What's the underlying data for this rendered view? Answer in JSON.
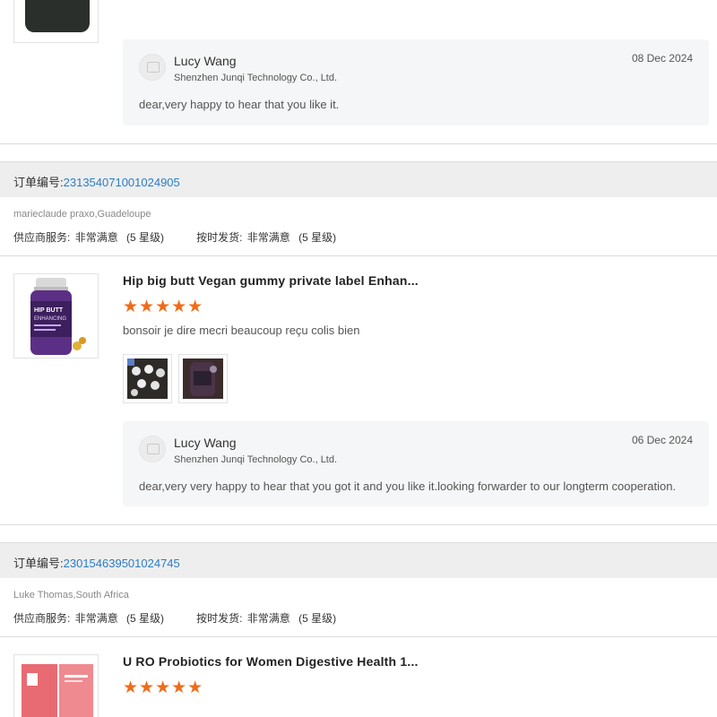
{
  "top_reply": {
    "name": "Lucy Wang",
    "company": "Shenzhen Junqi Technology Co., Ltd.",
    "date": "08 Dec 2024",
    "text": "dear,very happy to hear that you like it."
  },
  "orders": [
    {
      "label": "订单编号:",
      "number": "231354071001024905",
      "buyer": "marieclaude praxo,Guadeloupe",
      "supplier_service_label": "供应商服务:",
      "supplier_service_value": "非常满意",
      "supplier_service_level": "(5 星级)",
      "shipping_label": "按时发货:",
      "shipping_value": "非常满意",
      "shipping_level": "(5 星级)",
      "product_title": "Hip big butt Vegan gummy private label Enhan...",
      "stars": "★★★★★",
      "rating": 5,
      "review": "bonsoir  je dire  mecri beaucoup  reçu colis bien",
      "reply": {
        "name": "Lucy Wang",
        "company": "Shenzhen Junqi Technology Co., Ltd.",
        "date": "06 Dec 2024",
        "text": "dear,very very happy to hear that you got it and you like it.looking forwarder to our longterm cooperation."
      }
    },
    {
      "label": "订单编号:",
      "number": "230154639501024745",
      "buyer": "Luke Thomas,South Africa",
      "supplier_service_label": "供应商服务:",
      "supplier_service_value": "非常满意",
      "supplier_service_level": "(5 星级)",
      "shipping_label": "按时发货:",
      "shipping_value": "非常满意",
      "shipping_level": "(5 星级)",
      "product_title": "U RO Probiotics for Women Digestive Health 1...",
      "stars": "★★★★★",
      "rating": 5
    }
  ],
  "colors": {
    "star": "#f06c1a",
    "order_number": "#2a7dc9",
    "reply_bg": "#f5f6f7",
    "order_bar_bg": "#eeeeee"
  }
}
